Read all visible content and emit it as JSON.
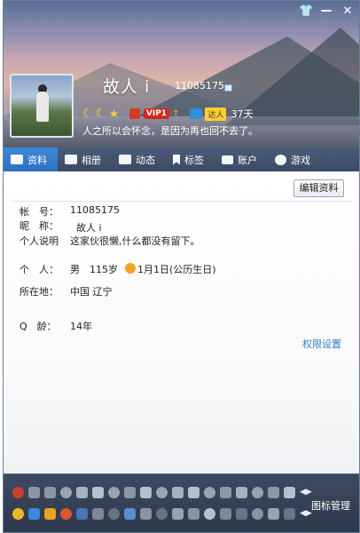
{
  "window": {
    "buttons": {
      "skin": "👕",
      "minimize": "—",
      "close": "✕"
    }
  },
  "profile": {
    "nickname": "故人 i",
    "qq_number": "11085175",
    "level_moons": [
      "☾",
      "☾"
    ],
    "level_star": "★",
    "vip_label": "VIP1",
    "vip_arrow": "↑",
    "daren_label": "达人",
    "active_days": "37天",
    "signature": "人之所以会怀念，是因为再也回不去了。"
  },
  "tabs": [
    {
      "label": "资料",
      "icon": "card-icon",
      "active": true
    },
    {
      "label": "相册",
      "icon": "photo-icon",
      "active": false
    },
    {
      "label": "动态",
      "icon": "feed-icon",
      "active": false
    },
    {
      "label": "标签",
      "icon": "tag-icon",
      "active": false
    },
    {
      "label": "账户",
      "icon": "wallet-icon",
      "active": false
    },
    {
      "label": "游戏",
      "icon": "game-icon",
      "active": false
    }
  ],
  "details": {
    "edit_button": "编辑资料",
    "account_label": "帐　号：",
    "account_value": "11085175",
    "nickname_label": "昵　称：",
    "nickname_value": "故人 i",
    "bio_label": "个人说明",
    "bio_value": "这家伙很懒,什么都没有留下。",
    "personal_label": "个　人：",
    "gender": "男",
    "age": "115岁",
    "birthday": "1月1日(公历生日)",
    "location_label": "所在地：",
    "location_value": "中国 辽宁",
    "qage_label": "Q　龄：",
    "qage_value": "14年",
    "permission_link": "权限设置"
  },
  "iconbar": {
    "row1_count": 18,
    "row2_count": 18,
    "manage_label": "图标管理",
    "arrows": "◀▶"
  }
}
